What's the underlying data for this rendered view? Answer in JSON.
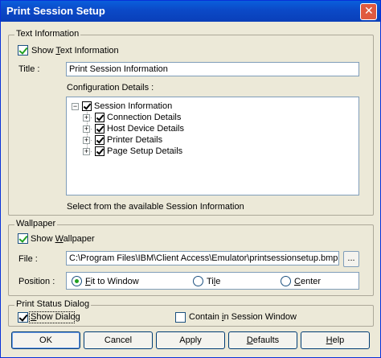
{
  "window": {
    "title": "Print Session Setup",
    "close_glyph": "✕"
  },
  "text_info": {
    "legend": "Text Information",
    "show_label_pre": "Show ",
    "show_label_u": "T",
    "show_label_post": "ext Information",
    "title_label": "Title :",
    "title_value": "Print Session Information",
    "config_label": "Configuration Details :",
    "tree": {
      "root": "Session Information",
      "children": [
        "Connection Details",
        "Host Device Details",
        "Printer Details",
        "Page Setup Details"
      ]
    },
    "hint": "Select from the available Session Information"
  },
  "wallpaper": {
    "legend": "Wallpaper",
    "show_label_pre": "Show ",
    "show_label_u": "W",
    "show_label_post": "allpaper",
    "file_label": "File :",
    "file_value": "C:\\Program Files\\IBM\\Client Access\\Emulator\\printsessionsetup.bmp",
    "browse_label": "...",
    "position_label": "Position :",
    "options": [
      {
        "pre": "",
        "u": "F",
        "post": "it to Window",
        "selected": true
      },
      {
        "pre": "Ti",
        "u": "l",
        "post": "e",
        "selected": false
      },
      {
        "pre": "",
        "u": "C",
        "post": "enter",
        "selected": false
      }
    ]
  },
  "status": {
    "legend": "Print Status Dialog",
    "show_dialog_pre": "",
    "show_dialog_u": "S",
    "show_dialog_post": "how Dialog",
    "contain_pre": "Contain ",
    "contain_u": "i",
    "contain_post": "n Session Window"
  },
  "buttons": {
    "ok": "OK",
    "cancel": "Cancel",
    "apply": "Apply",
    "defaults_pre": "",
    "defaults_u": "D",
    "defaults_post": "efaults",
    "help_pre": "",
    "help_u": "H",
    "help_post": "elp"
  },
  "colors": {
    "titlebar": "#0b49c7",
    "dialog_bg": "#ece9d8",
    "checkmark": "#21a121",
    "close_button": "#e05a3f"
  }
}
